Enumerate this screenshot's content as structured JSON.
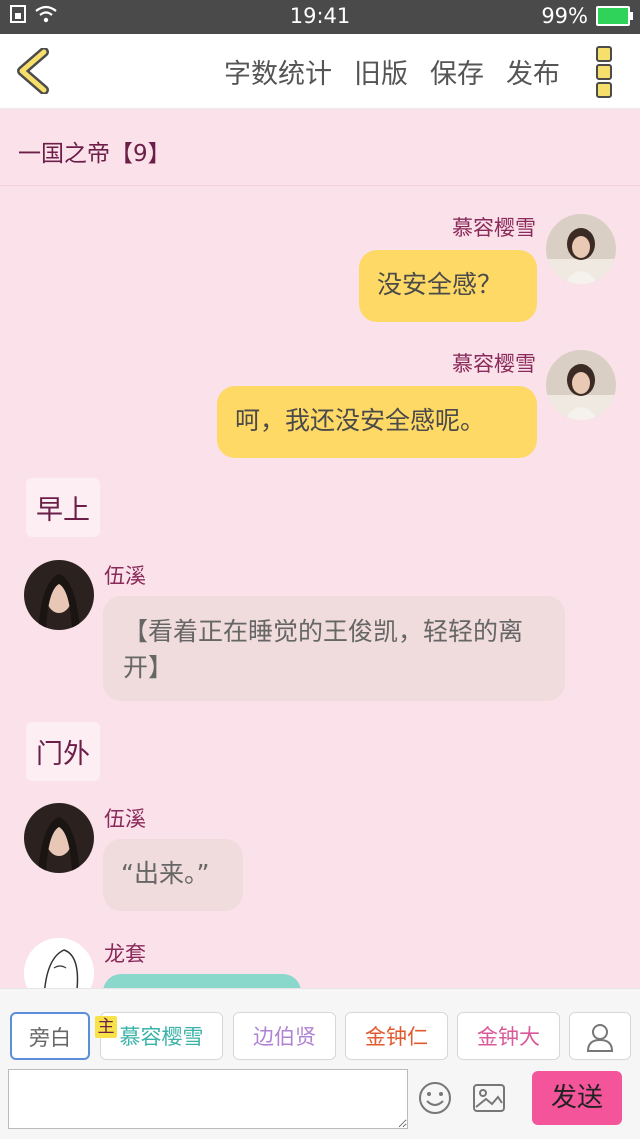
{
  "status": {
    "time": "19:41",
    "battery": "99%"
  },
  "nav": {
    "actions": [
      "字数统计",
      "旧版",
      "保存",
      "发布"
    ]
  },
  "chapter": {
    "title": "一国之帝【9】"
  },
  "messages": [
    {
      "speaker": "慕容樱雪",
      "text": "没安全感？"
    },
    {
      "speaker": "慕容樱雪",
      "text": "呵，我还没安全感呢。"
    },
    {
      "scene": "早上"
    },
    {
      "speaker": "伍溪",
      "text": "【看着正在睡觉的王俊凯，轻轻的离开】"
    },
    {
      "scene": "门外"
    },
    {
      "speaker": "伍溪",
      "text": "“出来。”"
    },
    {
      "speaker": "龙套",
      "text": ""
    }
  ],
  "roles": [
    "旁白",
    "慕容樱雪",
    "边伯贤",
    "金钟仁",
    "金钟大"
  ],
  "role_colors": [
    "#666666",
    "#3bb3a8",
    "#b083d3",
    "#e05a2e",
    "#d95a9a"
  ],
  "host_badge": "主",
  "input": {
    "placeholder": ""
  },
  "send_label": "发送"
}
